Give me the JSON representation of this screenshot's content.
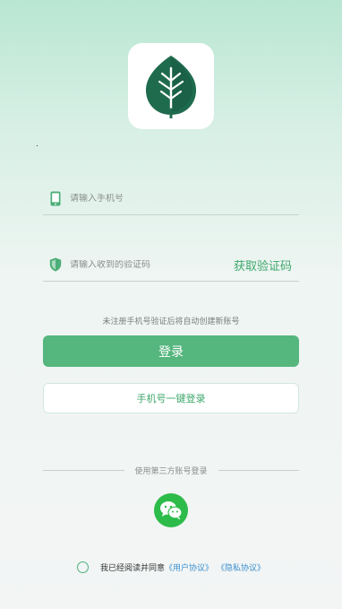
{
  "colors": {
    "accent": "#55b67e",
    "accent_text": "#3fa86d",
    "link": "#3a8fd0",
    "wechat": "#2dbb49",
    "logo_leaf": "#1f6b4e"
  },
  "logo": {
    "icon": "leaf-icon"
  },
  "form": {
    "phone": {
      "icon": "phone-icon",
      "placeholder": "请输入手机号",
      "value": ""
    },
    "code": {
      "icon": "shield-icon",
      "placeholder": "请输入收到的验证码",
      "value": "",
      "get_code_label": "获取验证码"
    },
    "hint": "未注册手机号验证后将自动创建新账号",
    "login_label": "登录",
    "onekey_label": "手机号一键登录"
  },
  "third_party": {
    "label": "使用第三方账号登录",
    "wechat_icon": "wechat-icon"
  },
  "agreement": {
    "prefix": "我已经阅读并同意",
    "user_agreement": "《用户协议》",
    "privacy_policy": "《隐私协议》"
  }
}
